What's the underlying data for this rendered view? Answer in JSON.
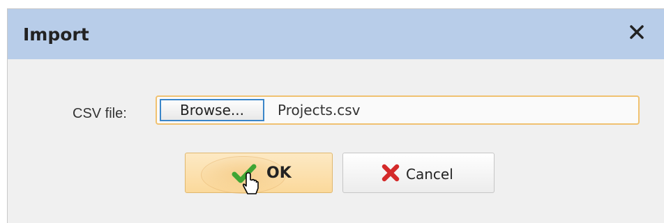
{
  "dialog": {
    "title": "Import",
    "close_icon": "close-icon",
    "csv_label": "CSV file:",
    "browse_label": "Browse...",
    "file_name": "Projects.csv",
    "ok_label": "OK",
    "cancel_label": "Cancel",
    "ok_icon": "checkmark-icon",
    "cancel_icon": "x-icon"
  },
  "colors": {
    "titlebar": "#b8cde9",
    "ok_button": "#fbd99b",
    "field_focus": "#f0c170",
    "browse_border": "#3b86c9"
  }
}
